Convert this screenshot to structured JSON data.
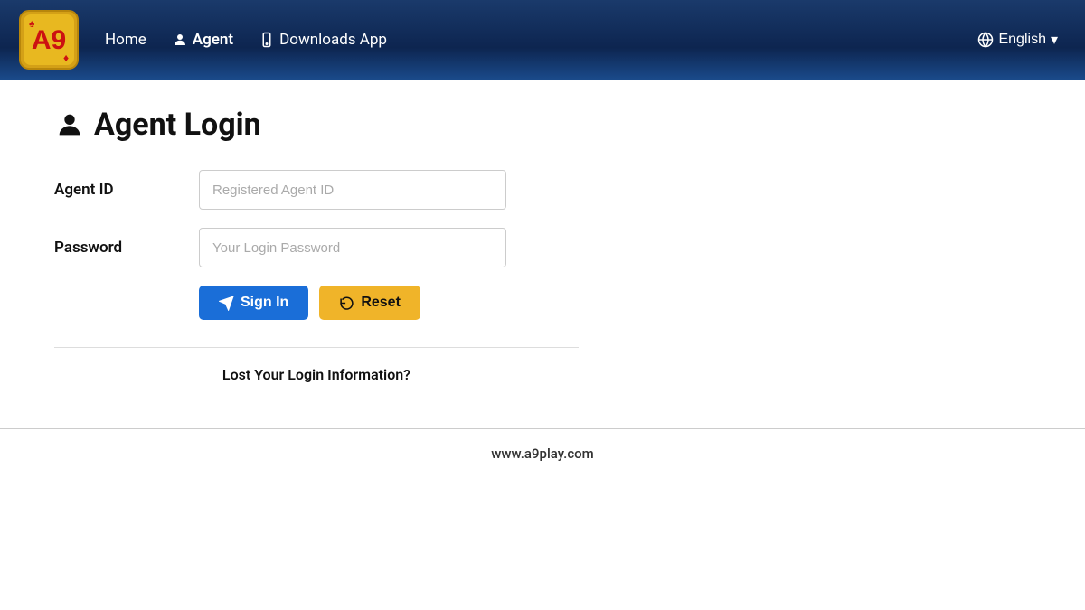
{
  "navbar": {
    "logo_alt": "A9 Logo",
    "nav_home": "Home",
    "nav_agent": "Agent",
    "nav_downloads": "Downloads App",
    "language": "English"
  },
  "page": {
    "title": "Agent Login",
    "title_icon": "👤"
  },
  "form": {
    "agent_id_label": "Agent ID",
    "agent_id_placeholder": "Registered Agent ID",
    "password_label": "Password",
    "password_placeholder": "Your Login Password",
    "signin_label": "Sign In",
    "reset_label": "Reset",
    "lost_info_label": "Lost Your Login Information?"
  },
  "footer": {
    "website": "www.a9play.com"
  }
}
